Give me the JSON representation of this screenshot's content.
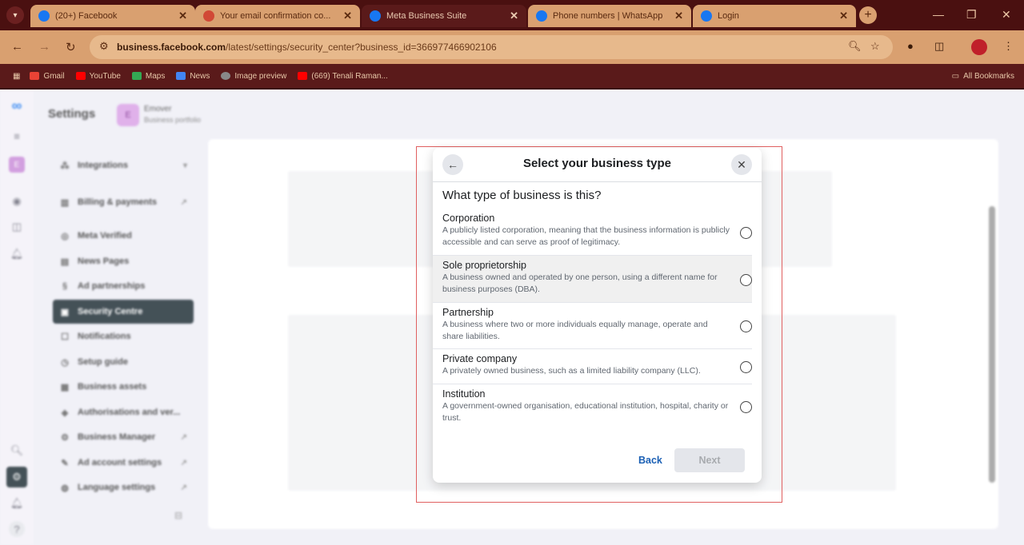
{
  "browser": {
    "tabs": [
      {
        "title": "(20+) Facebook",
        "favicon_color": "#1877f2"
      },
      {
        "title": "Your email confirmation co...",
        "favicon_color": "#d14836"
      },
      {
        "title": "Meta Business Suite",
        "favicon_color": "#1877f2"
      },
      {
        "title": "Phone numbers | WhatsApp",
        "favicon_color": "#1877f2"
      },
      {
        "title": "Login",
        "favicon_color": "#1877f2"
      }
    ],
    "url_host": "business.facebook.com",
    "url_path": "/latest/settings/security_center?business_id=366977466902106",
    "bookmarks": [
      {
        "label": "Gmail",
        "color": "#ea4335"
      },
      {
        "label": "YouTube",
        "color": "#ff0000"
      },
      {
        "label": "Maps",
        "color": "#34a853"
      },
      {
        "label": "News",
        "color": "#4285f4"
      },
      {
        "label": "Image preview",
        "color": "#888888"
      },
      {
        "label": "(669) Tenali Raman...",
        "color": "#ff0000"
      }
    ],
    "all_bookmarks": "All Bookmarks"
  },
  "settings": {
    "title": "Settings",
    "portfolio_initial": "E",
    "portfolio_name": "Emover",
    "portfolio_sub": "Business portfolio",
    "menu": [
      {
        "label": "Integrations",
        "icon": "integrations-icon"
      },
      {
        "label": "Billing & payments",
        "icon": "billing-icon"
      },
      {
        "label": "Meta Verified",
        "icon": "verified-icon"
      },
      {
        "label": "News Pages",
        "icon": "news-icon"
      },
      {
        "label": "Ad partnerships",
        "icon": "partnership-icon"
      },
      {
        "label": "Security Centre",
        "icon": "lock-icon"
      },
      {
        "label": "Notifications",
        "icon": "notifications-icon"
      },
      {
        "label": "Setup guide",
        "icon": "guide-icon"
      },
      {
        "label": "Business assets",
        "icon": "assets-icon"
      },
      {
        "label": "Authorisations and ver...",
        "icon": "shield-icon"
      },
      {
        "label": "Business Manager",
        "icon": "gear-icon"
      },
      {
        "label": "Ad account settings",
        "icon": "ad-account-icon"
      },
      {
        "label": "Language settings",
        "icon": "globe-icon"
      }
    ]
  },
  "modal": {
    "title": "Select your business type",
    "question": "What type of business is this?",
    "options": [
      {
        "title": "Corporation",
        "desc": "A publicly listed corporation, meaning that the business information is publicly accessible and can serve as proof of legitimacy."
      },
      {
        "title": "Sole proprietorship",
        "desc": "A business owned and operated by one person, using a different name for business purposes (DBA)."
      },
      {
        "title": "Partnership",
        "desc": "A business where two or more individuals equally manage, operate and share liabilities."
      },
      {
        "title": "Private company",
        "desc": "A privately owned business, such as a limited liability company (LLC)."
      },
      {
        "title": "Institution",
        "desc": "A government-owned organisation, educational institution, hospital, charity or trust."
      }
    ],
    "back_label": "Back",
    "next_label": "Next"
  }
}
